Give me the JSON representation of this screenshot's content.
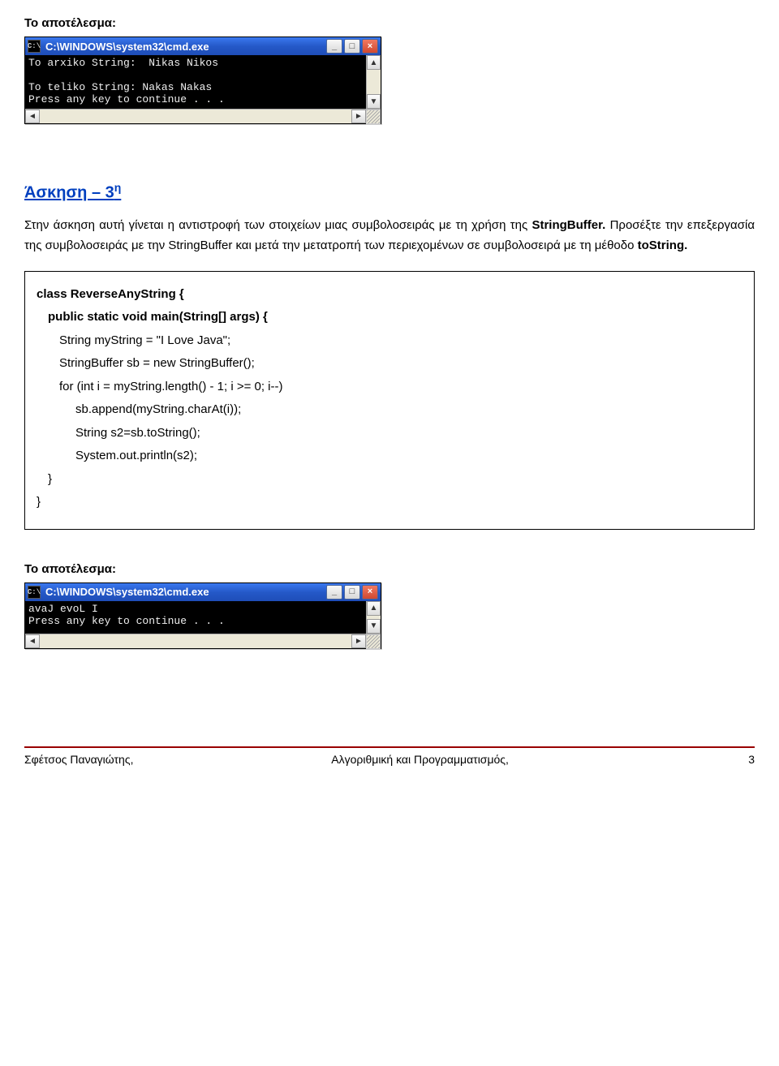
{
  "labels": {
    "result1": "Το αποτέλεσμα:",
    "result2": "Το αποτέλεσμα:"
  },
  "cmd1": {
    "sysicon": "C:\\",
    "title": "C:\\WINDOWS\\system32\\cmd.exe",
    "btn_min": "_",
    "btn_max": "□",
    "btn_close": "×",
    "content": "To arxiko String:  Nikas Nikos\n\nTo teliko String: Nakas Nakas\nPress any key to continue . . .",
    "scroll_up": "▲",
    "scroll_down": "▼",
    "scroll_left": "◄",
    "scroll_right": "►"
  },
  "exercise": {
    "heading_prefix": "Άσκηση – 3",
    "heading_sup": "η",
    "para1_a": "Στην άσκηση αυτή γίνεται η αντιστροφή των στοιχείων μιας συμβολοσειράς με τη χρήση της ",
    "para1_b": "StringBuffer.",
    "para1_c": " Προσέξτε την επεξεργασία της συμβολοσειράς με την StringBuffer και μετά την μετατροπή των περιεχομένων σε συμβολοσειρά με τη μέθοδο ",
    "para1_d": "toString."
  },
  "code": {
    "l1": "class ReverseAnyString {",
    "l2": "public static void main(String[] args) {",
    "l3": "String myString = \"I Love Java\";",
    "l4": "StringBuffer sb = new StringBuffer();",
    "l5": "for (int i = myString.length() - 1; i >= 0; i--)",
    "l6": "sb.append(myString.charAt(i));",
    "l7": "String s2=sb.toString();",
    "l8": "System.out.println(s2);",
    "l9": "}",
    "l10": "}"
  },
  "cmd2": {
    "sysicon": "C:\\",
    "title": "C:\\WINDOWS\\system32\\cmd.exe",
    "btn_min": "_",
    "btn_max": "□",
    "btn_close": "×",
    "content": "avaJ evoL I\nPress any key to continue . . .\n",
    "scroll_up": "▲",
    "scroll_down": "▼",
    "scroll_left": "◄",
    "scroll_right": "►"
  },
  "footer": {
    "left": "Σφέτσος  Παναγιώτης,",
    "center": "Αλγοριθμική και Προγραμματισμός,",
    "page": "3"
  }
}
